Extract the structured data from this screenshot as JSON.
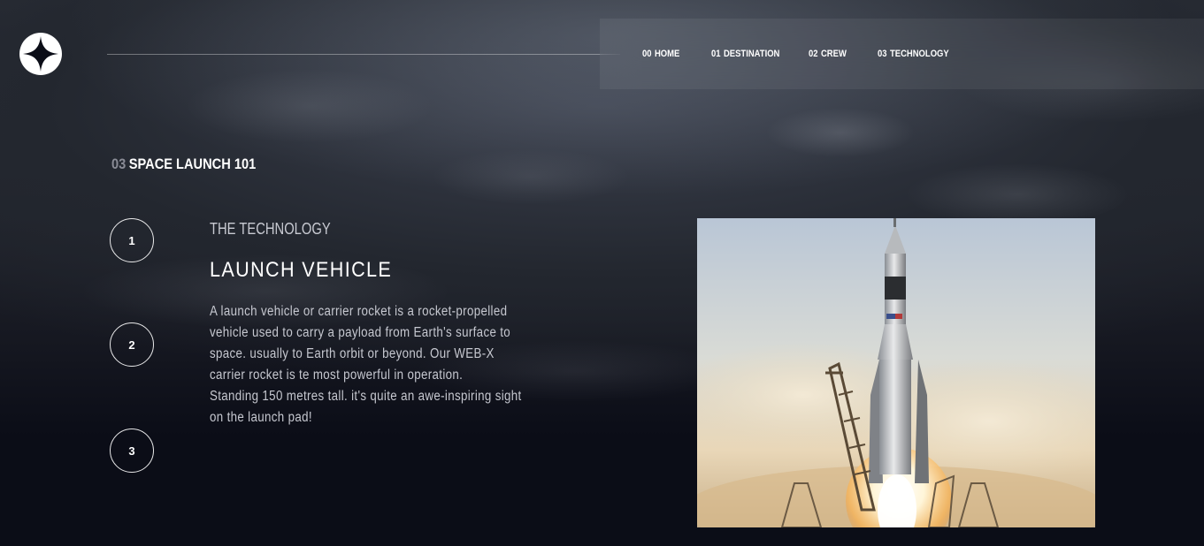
{
  "nav": {
    "items": [
      {
        "num": "00",
        "label": "HOME"
      },
      {
        "num": "01",
        "label": "DESTINATION"
      },
      {
        "num": "02",
        "label": "CREW"
      },
      {
        "num": "03",
        "label": "TECHNOLOGY"
      }
    ]
  },
  "page": {
    "section_num": "03",
    "section_title": "SPACE LAUNCH 101"
  },
  "steps": [
    "1",
    "2",
    "3"
  ],
  "content": {
    "eyebrow": "THE TECHNOLOGY",
    "title": "LAUNCH VEHICLE",
    "description_lines": [
      "A launch vehicle or carrier rocket is a rocket-propelled",
      "vehicle used to carry a payload from Earth's surface to",
      "space. usually to Earth orbit or beyond. Our WEB-X",
      "carrier rocket is te most powerful in operation.",
      "Standing 150 metres tall. it's quite an awe-inspiring sight",
      "on the launch pad!"
    ]
  },
  "colors": {
    "background": "#0b0d17",
    "text": "#ffffff",
    "muted": "#8a8c96",
    "body_text": "#c6c8d0"
  }
}
